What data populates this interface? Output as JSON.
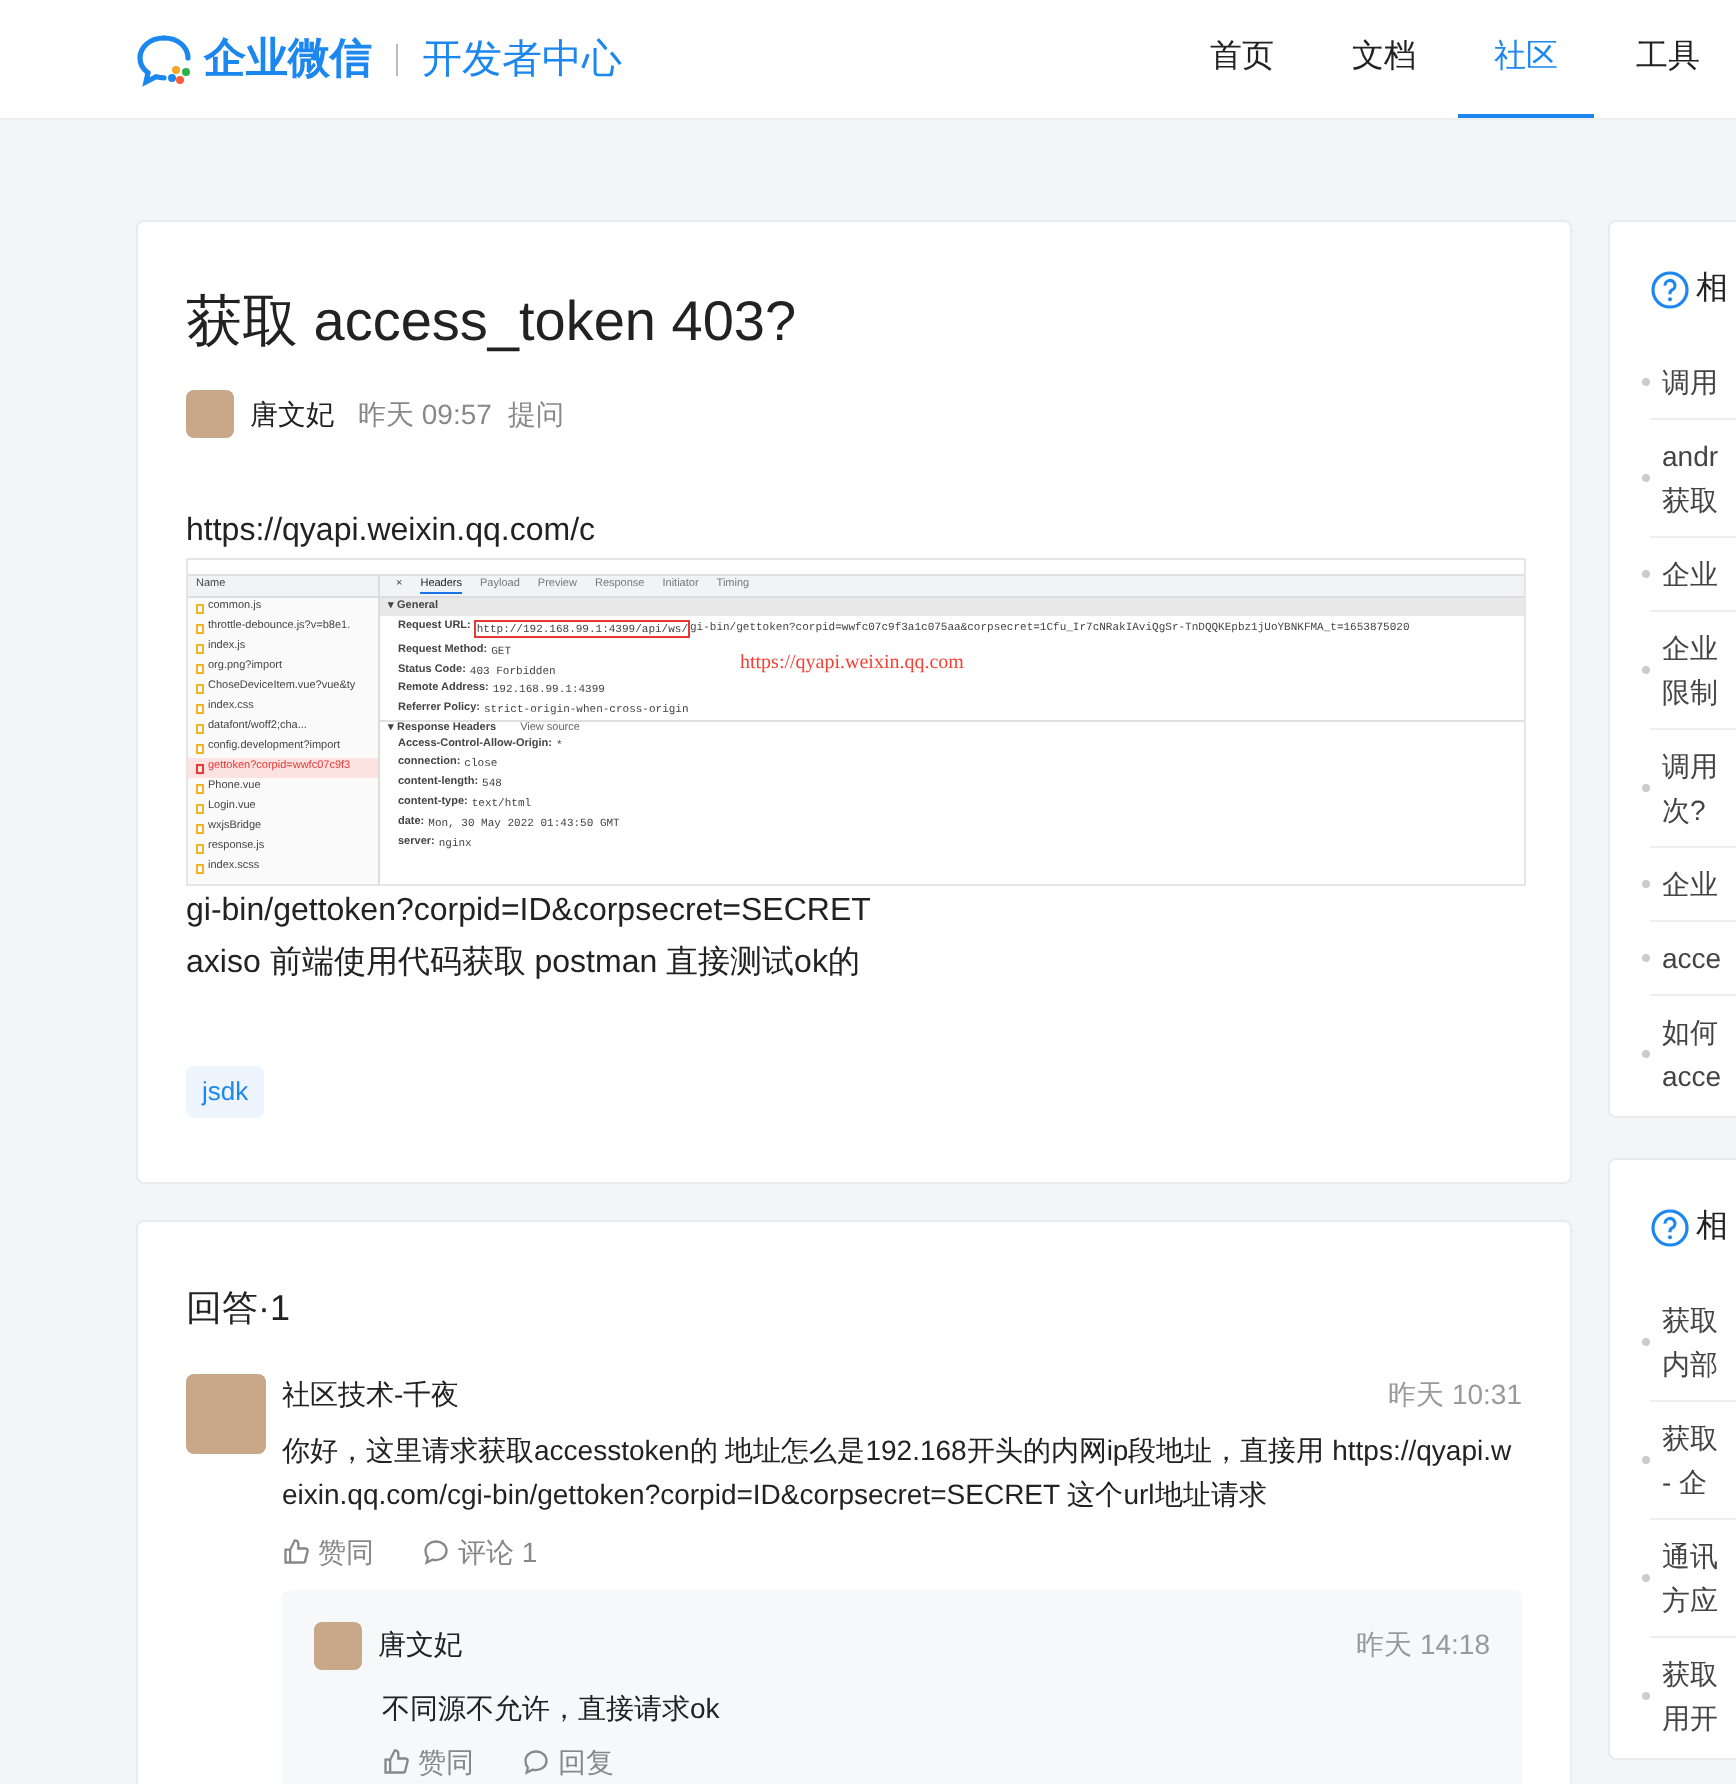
{
  "header": {
    "brand": "企业微信",
    "subtitle": "开发者中心",
    "nav": [
      {
        "label": "首页",
        "selected": false
      },
      {
        "label": "文档",
        "selected": false
      },
      {
        "label": "社区",
        "selected": true
      },
      {
        "label": "工具",
        "selected": false
      }
    ]
  },
  "question": {
    "title": "获取 access_token 403?",
    "author": "唐文妃",
    "time": "昨天 09:57",
    "action": "提问",
    "body_before": "https://qyapi.weixin.qq.com/c",
    "devtools": {
      "files": [
        {
          "name": "common.js",
          "selected": false
        },
        {
          "name": "throttle-debounce.js?v=b8e1.",
          "selected": false
        },
        {
          "name": "index.js",
          "selected": false
        },
        {
          "name": "org.png?import",
          "selected": false
        },
        {
          "name": "ChoseDeviceItem.vue?vue&ty",
          "selected": false
        },
        {
          "name": "index.css",
          "selected": false
        },
        {
          "name": "datafont/woff2;cha...",
          "selected": false
        },
        {
          "name": "config.development?import",
          "selected": false
        },
        {
          "name": "gettoken?corpid=wwfc07c9f3",
          "selected": true
        },
        {
          "name": "Phone.vue",
          "selected": false
        },
        {
          "name": "Login.vue",
          "selected": false
        },
        {
          "name": "wxjsBridge",
          "selected": false
        },
        {
          "name": "response.js",
          "selected": false
        },
        {
          "name": "index.scss",
          "selected": false
        }
      ],
      "name_header": "Name",
      "close": "×",
      "tabs": [
        {
          "label": "Headers",
          "selected": true
        },
        {
          "label": "Payload",
          "selected": false
        },
        {
          "label": "Preview",
          "selected": false
        },
        {
          "label": "Response",
          "selected": false
        },
        {
          "label": "Initiator",
          "selected": false
        },
        {
          "label": "Timing",
          "selected": false
        }
      ],
      "general_title": "▾ General",
      "request_url_label": "Request URL:",
      "request_url_boxed": "http://192.168.99.1:4399/api/ws/",
      "request_url_rest": "gi-bin/gettoken?corpid=wwfc07c9f3a1c075aa&corpsecret=1Cfu_Ir7cNRakIAviQgSr-TnDQQKEpbz1jUoYBNKFMA_t=1653875020",
      "general": [
        {
          "label": "Request Method:",
          "value": "GET"
        },
        {
          "label": "Status Code:",
          "value": "403 Forbidden"
        },
        {
          "label": "Remote Address:",
          "value": "192.168.99.1:4399"
        },
        {
          "label": "Referrer Policy:",
          "value": "strict-origin-when-cross-origin"
        }
      ],
      "annotation": "https://qyapi.weixin.qq.com",
      "response_title": "▾ Response Headers",
      "view_source": "View source",
      "response": [
        {
          "label": "Access-Control-Allow-Origin:",
          "value": "*"
        },
        {
          "label": "connection:",
          "value": "close"
        },
        {
          "label": "content-length:",
          "value": "548"
        },
        {
          "label": "content-type:",
          "value": "text/html"
        },
        {
          "label": "date:",
          "value": "Mon, 30 May 2022 01:43:50 GMT"
        },
        {
          "label": "server:",
          "value": "nginx"
        }
      ]
    },
    "body_after": [
      "gi-bin/gettoken?corpid=ID&corpsecret=SECRET",
      "axiso 前端使用代码获取 postman 直接测试ok的"
    ],
    "tags": [
      "jsdk"
    ]
  },
  "answers": {
    "title": "回答·1",
    "items": [
      {
        "author": "社区技术-千夜",
        "time": "昨天 10:31",
        "text": "你好，这里请求获取accesstoken的 地址怎么是192.168开头的内网ip段地址，直接用 https://qyapi.weixin.qq.com/cgi-bin/gettoken?corpid=ID&corpsecret=SECRET 这个url地址请求",
        "like": "赞同",
        "comment": "评论 1",
        "replies": [
          {
            "author": "唐文妃",
            "time": "昨天 14:18",
            "text": "不同源不允许，直接请求ok",
            "like": "赞同",
            "reply": "回复"
          }
        ]
      }
    ]
  },
  "sidebar": [
    {
      "heading": "相",
      "items": [
        [
          "调用"
        ],
        [
          "andr",
          "获取"
        ],
        [
          "企业"
        ],
        [
          "企业",
          "限制"
        ],
        [
          "调用",
          "次?"
        ],
        [
          "企业"
        ],
        [
          "acce"
        ],
        [
          "如何",
          "acce"
        ]
      ]
    },
    {
      "heading": "相",
      "items": [
        [
          "获取",
          "内部"
        ],
        [
          "获取",
          "- 企"
        ],
        [
          "通讯",
          "方应"
        ],
        [
          "获取",
          "用开"
        ]
      ]
    }
  ]
}
